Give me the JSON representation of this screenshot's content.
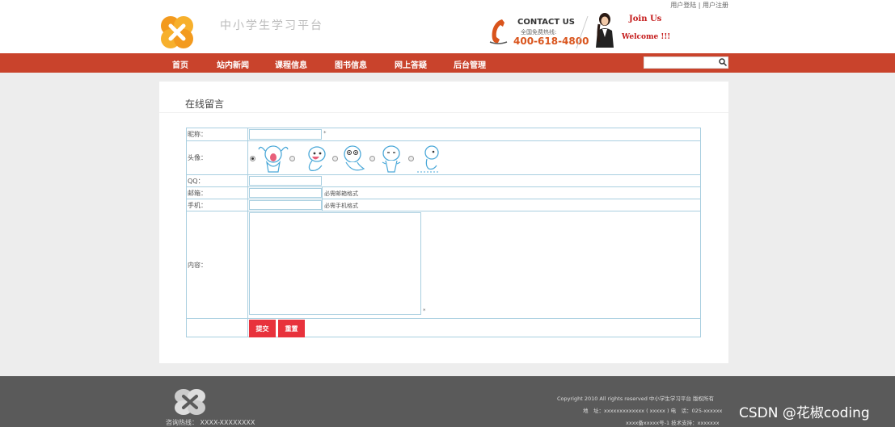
{
  "header": {
    "top_links": {
      "login": "用户登陆",
      "separator": "|",
      "register": "用户注册"
    },
    "site_title": "中小学生学习平台",
    "contact": {
      "title": "CONTACT US",
      "subtitle": "全国免费热线:",
      "phone": "400-618-4800"
    },
    "join": "Join Us",
    "welcome": "Welcome !!!"
  },
  "nav": {
    "items": [
      "首页",
      "站内新闻",
      "课程信息",
      "图书信息",
      "网上答疑",
      "后台管理"
    ],
    "search_placeholder": ""
  },
  "main": {
    "section_title": "在线留言",
    "form": {
      "nickname_label": "昵称：",
      "nickname_required": "*",
      "avatar_label": "头像：",
      "avatar_options": [
        "avatar-1",
        "avatar-2",
        "avatar-3",
        "avatar-4",
        "avatar-5"
      ],
      "avatar_selected_index": 0,
      "qq_label": "QQ：",
      "email_label": "邮箱：",
      "email_note": "必需邮箱格式",
      "phone_label": "手机：",
      "phone_note": "必需手机格式",
      "content_label": "内容：",
      "content_required": "*",
      "submit_label": "提交",
      "reset_label": "重置"
    }
  },
  "footer": {
    "hotline": "咨询热线： XXXX-XXXXXXXX",
    "copyright": "Copyright 2010 All rights reserved 中小学生学习平台 版权所有",
    "address": "地　址：xxxxxxxxxxxxx ( xxxxx ) 电　话：025-xxxxxx",
    "icp": "xxxx备xxxxx号-1 技术支持：xxxxxxx"
  },
  "watermark": "CSDN @花椒coding",
  "colors": {
    "nav_bg": "#c9432c",
    "button_bg": "#e8323c",
    "footer_bg": "#5a5a5a",
    "border": "#a9cfe0",
    "accent_orange": "#f39a1e"
  }
}
